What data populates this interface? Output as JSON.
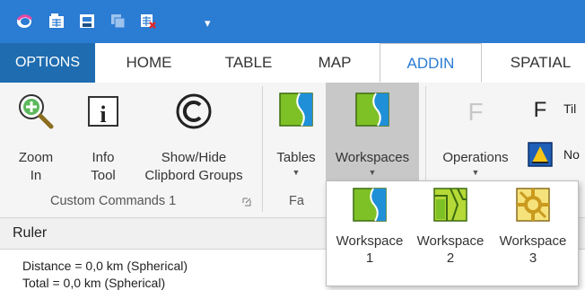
{
  "qat": {
    "icons": [
      "app-logo-icon",
      "workspace-open-icon",
      "save-icon",
      "copy-icon",
      "close-table-icon"
    ],
    "more": "▾"
  },
  "tabs": [
    "OPTIONS",
    "HOME",
    "TABLE",
    "MAP",
    "ADDIN",
    "SPATIAL"
  ],
  "active_tab": "ADDIN",
  "ribbon": {
    "zoom_in": [
      "Zoom",
      "In"
    ],
    "info_tool": [
      "Info",
      "Tool"
    ],
    "show_hide": [
      "Show/Hide",
      "Clipbord Groups"
    ],
    "custom_group_label": "Custom Commands 1",
    "tables_label": "Tables",
    "workspaces_label": "Workspaces",
    "fa_group_label": "Fa",
    "operations_label": "Operations",
    "tile_label": "Til",
    "no_label": "No"
  },
  "ruler": {
    "title": "Ruler",
    "distance": "Distance   = 0,0 km (Spherical)",
    "total": "Total        = 0,0 km (Spherical)"
  },
  "dropdown": {
    "items": [
      {
        "l1": "Workspace",
        "l2": "1"
      },
      {
        "l1": "Workspace",
        "l2": "2"
      },
      {
        "l1": "Workspace",
        "l2": "3"
      }
    ]
  },
  "colors": {
    "accent": "#2b7cd3",
    "options_tab": "#1f6cb0",
    "map_green": "#7ec126",
    "map_blue": "#1f8fd8",
    "pressed": "#c8c8c8"
  }
}
